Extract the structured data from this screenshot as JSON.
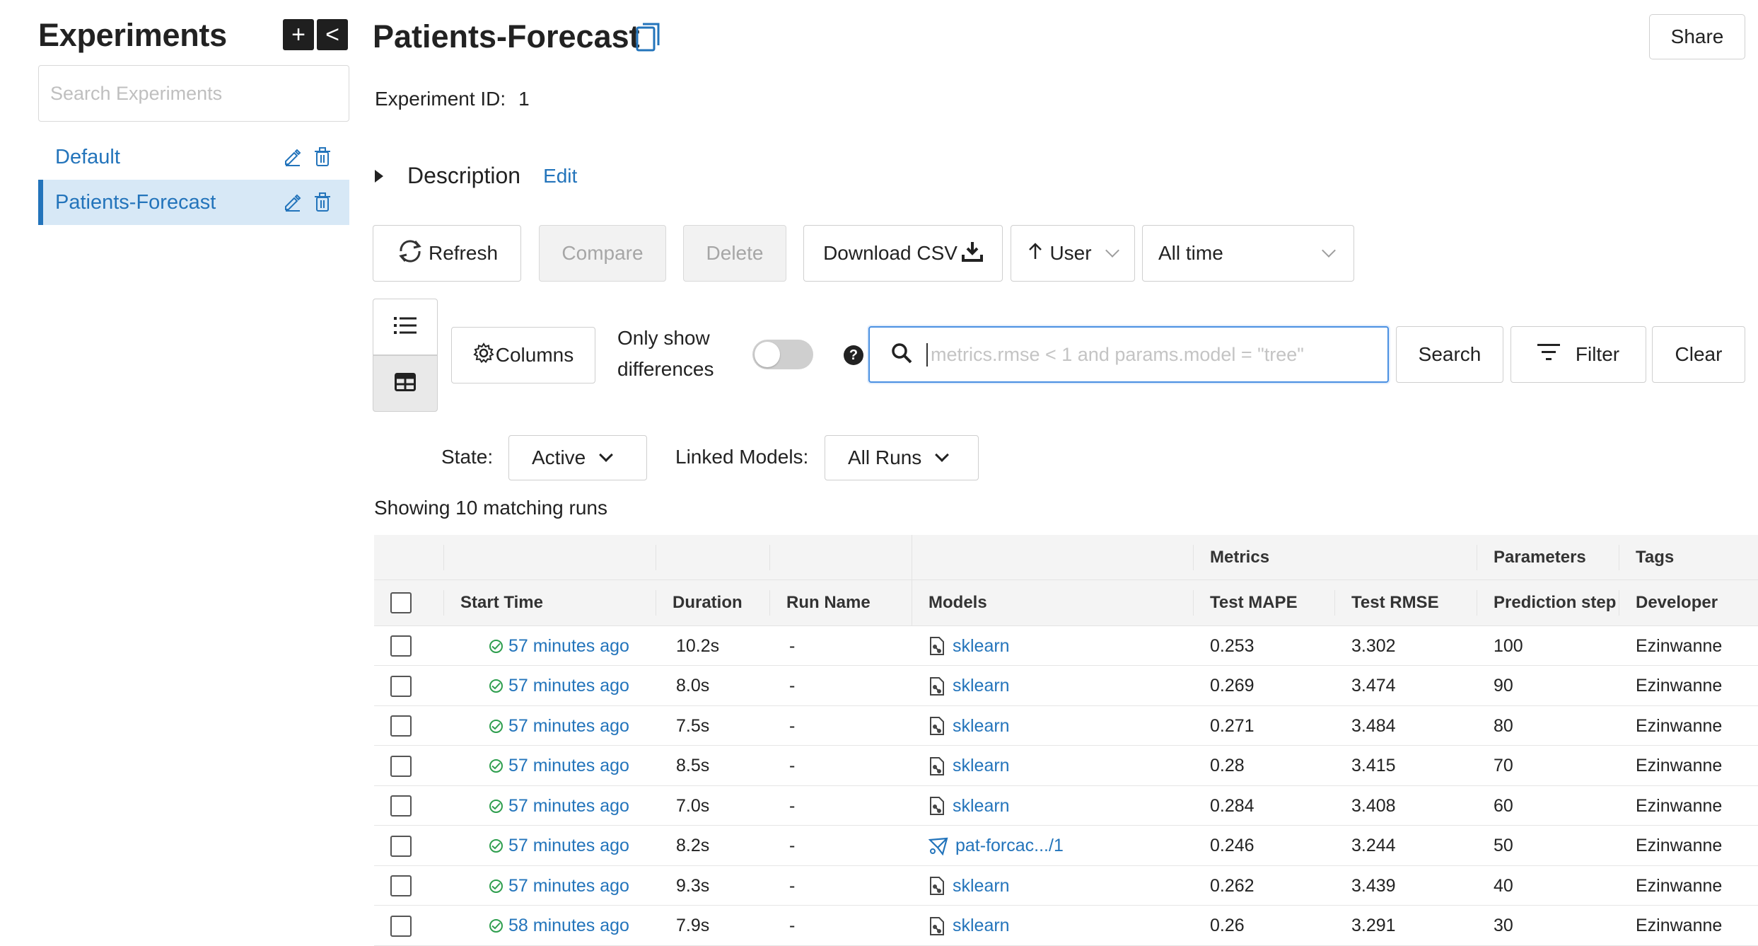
{
  "sidebar": {
    "title": "Experiments",
    "add_label": "+",
    "collapse_label": "<",
    "search_placeholder": "Search Experiments",
    "items": [
      {
        "label": "Default"
      },
      {
        "label": "Patients-Forecast"
      }
    ]
  },
  "header": {
    "title": "Patients-Forecast",
    "share_label": "Share",
    "experiment_id_label": "Experiment ID:",
    "experiment_id": "1",
    "description_label": "Description",
    "edit_label": "Edit"
  },
  "toolbar": {
    "refresh_label": "Refresh",
    "compare_label": "Compare",
    "delete_label": "Delete",
    "download_label": "Download CSV",
    "user_label": "User",
    "time_label": "All time",
    "columns_label": "Columns",
    "only_diff_line1": "Only show",
    "only_diff_line2": "differences",
    "search_placeholder": "metrics.rmse < 1 and params.model = \"tree\"",
    "search_label": "Search",
    "filter_label": "Filter",
    "clear_label": "Clear"
  },
  "filters": {
    "state_label": "State:",
    "state_value": "Active",
    "linked_label": "Linked Models:",
    "linked_value": "All Runs"
  },
  "showing_text": "Showing 10 matching runs",
  "table": {
    "group_headers": {
      "metrics": "Metrics",
      "parameters": "Parameters",
      "tags": "Tags"
    },
    "columns": [
      "Start Time",
      "Duration",
      "Run Name",
      "Models",
      "Test MAPE",
      "Test RMSE",
      "Prediction step",
      "Developer"
    ],
    "rows": [
      {
        "start": "57 minutes ago",
        "duration": "10.2s",
        "run_name": "-",
        "model": "sklearn",
        "model_type": "sklearn",
        "mape": "0.253",
        "rmse": "3.302",
        "step": "100",
        "dev": "Ezinwanne"
      },
      {
        "start": "57 minutes ago",
        "duration": "8.0s",
        "run_name": "-",
        "model": "sklearn",
        "model_type": "sklearn",
        "mape": "0.269",
        "rmse": "3.474",
        "step": "90",
        "dev": "Ezinwanne"
      },
      {
        "start": "57 minutes ago",
        "duration": "7.5s",
        "run_name": "-",
        "model": "sklearn",
        "model_type": "sklearn",
        "mape": "0.271",
        "rmse": "3.484",
        "step": "80",
        "dev": "Ezinwanne"
      },
      {
        "start": "57 minutes ago",
        "duration": "8.5s",
        "run_name": "-",
        "model": "sklearn",
        "model_type": "sklearn",
        "mape": "0.28",
        "rmse": "3.415",
        "step": "70",
        "dev": "Ezinwanne"
      },
      {
        "start": "57 minutes ago",
        "duration": "7.0s",
        "run_name": "-",
        "model": "sklearn",
        "model_type": "sklearn",
        "mape": "0.284",
        "rmse": "3.408",
        "step": "60",
        "dev": "Ezinwanne"
      },
      {
        "start": "57 minutes ago",
        "duration": "8.2s",
        "run_name": "-",
        "model": "pat-forcac.../1",
        "model_type": "registered",
        "mape": "0.246",
        "rmse": "3.244",
        "step": "50",
        "dev": "Ezinwanne"
      },
      {
        "start": "57 minutes ago",
        "duration": "9.3s",
        "run_name": "-",
        "model": "sklearn",
        "model_type": "sklearn",
        "mape": "0.262",
        "rmse": "3.439",
        "step": "40",
        "dev": "Ezinwanne"
      },
      {
        "start": "58 minutes ago",
        "duration": "7.9s",
        "run_name": "-",
        "model": "sklearn",
        "model_type": "sklearn",
        "mape": "0.26",
        "rmse": "3.291",
        "step": "30",
        "dev": "Ezinwanne"
      }
    ]
  },
  "colors": {
    "accent": "#2374bb",
    "success": "#2e9e4e",
    "focus": "#4a90e2"
  }
}
